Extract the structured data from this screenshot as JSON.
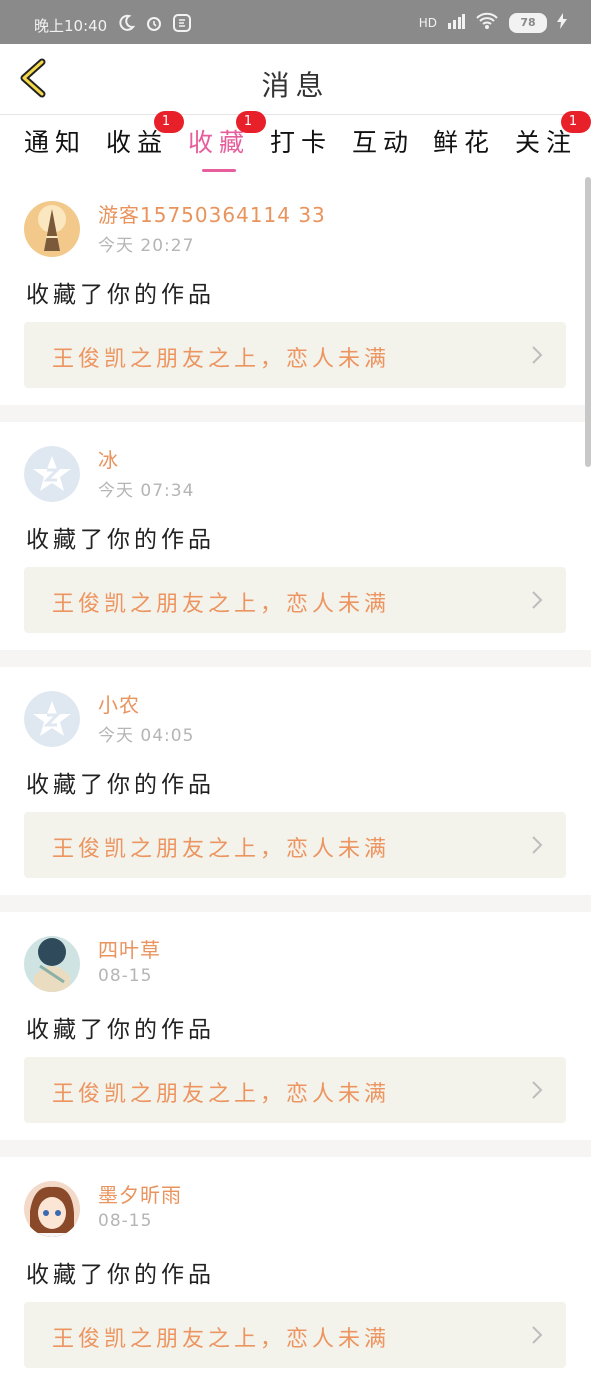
{
  "status_bar": {
    "time": "晚上10:40",
    "battery": "78",
    "network": "HD"
  },
  "header": {
    "title": "消息"
  },
  "tabs": [
    {
      "label": "通知",
      "badge": ""
    },
    {
      "label": "收益",
      "badge": "1"
    },
    {
      "label": "收藏",
      "badge": "1",
      "active": true
    },
    {
      "label": "打卡",
      "badge": ""
    },
    {
      "label": "互动",
      "badge": ""
    },
    {
      "label": "鲜花",
      "badge": ""
    },
    {
      "label": "关注",
      "badge": "1"
    }
  ],
  "feed": [
    {
      "name": "游客15750364114 33",
      "time": "今天 20:27",
      "action": "收藏了你的作品",
      "work": "王俊凯之朋友之上，恋人未满"
    },
    {
      "name": "冰",
      "time": "今天 07:34",
      "action": "收藏了你的作品",
      "work": "王俊凯之朋友之上，恋人未满"
    },
    {
      "name": "小农",
      "time": "今天 04:05",
      "action": "收藏了你的作品",
      "work": "王俊凯之朋友之上，恋人未满"
    },
    {
      "name": "四叶草",
      "time": "08-15",
      "action": "收藏了你的作品",
      "work": "王俊凯之朋友之上，恋人未满"
    },
    {
      "name": "墨夕昕雨",
      "time": "08-15",
      "action": "收藏了你的作品",
      "work": "王俊凯之朋友之上，恋人未满"
    }
  ],
  "colors": {
    "accent": "#e75e9c",
    "name": "#e9935d",
    "badge": "#e8202a"
  }
}
